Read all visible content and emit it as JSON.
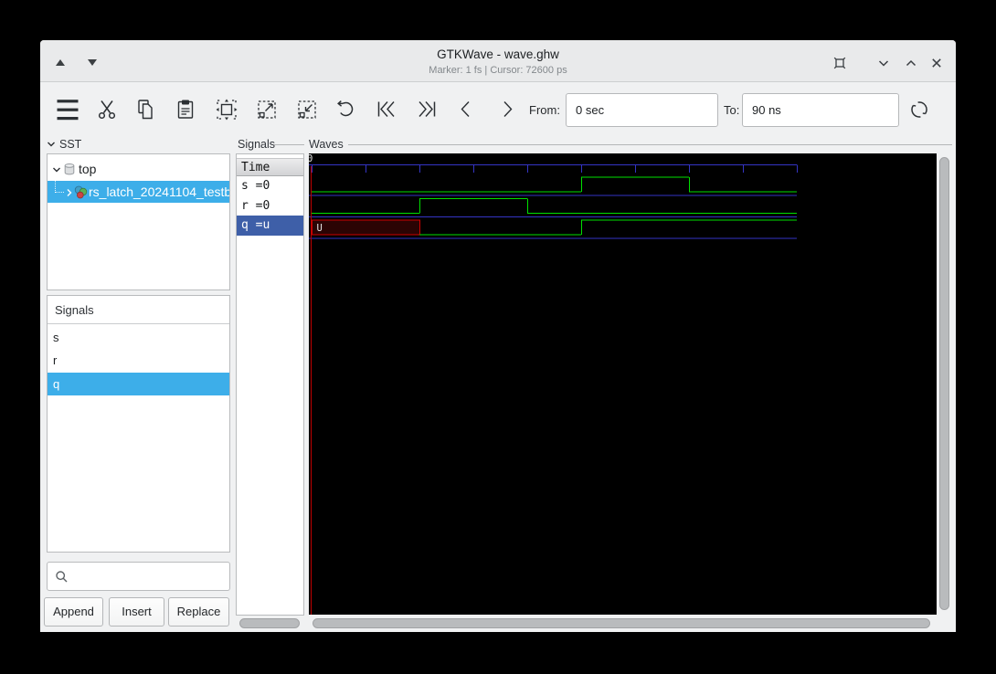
{
  "window": {
    "title": "GTKWave - wave.ghw",
    "subtitle": "Marker: 1 fs  |  Cursor: 72600 ps"
  },
  "toolbar": {
    "from_label": "From:",
    "from_value": "0 sec",
    "to_label": "To:",
    "to_value": "90 ns"
  },
  "sst": {
    "header": "SST",
    "tree": [
      {
        "label": "top",
        "icon": "cylinder",
        "expander": "down",
        "selected": false
      },
      {
        "label": "rs_latch_20241104_testb",
        "icon": "module",
        "expander": "right",
        "selected": true
      }
    ]
  },
  "signal_list": {
    "header": "Signals",
    "items": [
      {
        "label": "s",
        "selected": false
      },
      {
        "label": "r",
        "selected": false
      },
      {
        "label": "q",
        "selected": true
      }
    ],
    "search_value": "",
    "buttons": [
      "Append",
      "Insert",
      "Replace"
    ]
  },
  "signal_panel": {
    "frame_label": "Signals",
    "column_header": "Time",
    "rows": [
      {
        "label": "s =0",
        "selected": false
      },
      {
        "label": "r =0",
        "selected": false
      },
      {
        "label": "q =u",
        "selected": true
      }
    ]
  },
  "waves": {
    "frame_label": "Waves"
  },
  "chart_data": {
    "type": "digital-waveform",
    "time_unit": "ns",
    "from": 0,
    "to": 90,
    "ticks_ns": [
      0,
      10,
      20,
      30,
      40,
      50,
      60,
      70,
      80,
      90
    ],
    "timeline_zero_label": "0",
    "undefined_label": "U",
    "signals": [
      {
        "name": "s",
        "wave": [
          {
            "t": 0,
            "v": "0"
          },
          {
            "t": 50,
            "v": "1"
          },
          {
            "t": 70,
            "v": "0"
          }
        ],
        "end": 90
      },
      {
        "name": "r",
        "wave": [
          {
            "t": 0,
            "v": "0"
          },
          {
            "t": 20,
            "v": "1"
          },
          {
            "t": 40,
            "v": "0"
          }
        ],
        "end": 90
      },
      {
        "name": "q",
        "wave": [
          {
            "t": 0,
            "v": "U"
          },
          {
            "t": 20,
            "v": "0"
          },
          {
            "t": 50,
            "v": "1"
          }
        ],
        "end": 90
      }
    ],
    "colors": {
      "signal": "#00e000",
      "separator": "#3434c4",
      "timeline": "#3434c4",
      "undefined_fill": "#2b0404",
      "undefined_border": "#d00000",
      "marker": "#c00000",
      "text": "#e6e6e6"
    }
  }
}
